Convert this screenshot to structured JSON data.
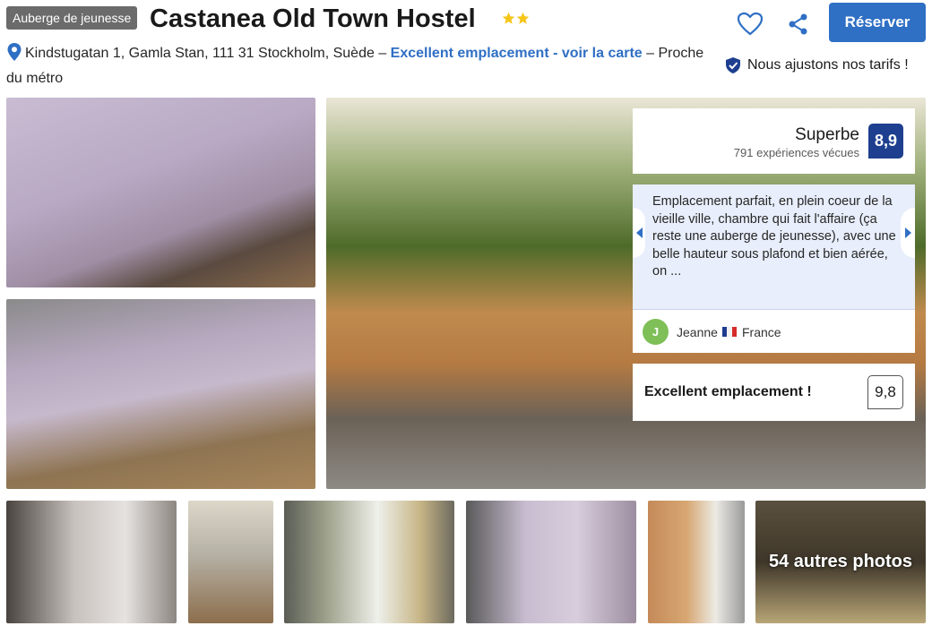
{
  "header": {
    "badge": "Auberge de jeunesse",
    "title": "Castanea Old Town Hostel",
    "stars": 2,
    "star_color": "#f5c518",
    "reserve_label": "Réserver",
    "favorite_icon": "heart-icon",
    "share_icon": "share-icon"
  },
  "address": {
    "text": "Kindstugatan 1, Gamla Stan, 111 31 Stockholm, Suède – ",
    "map_link": "Excellent emplacement - voir la carte",
    "suffix": " – Proche du métro",
    "pin_icon": "map-pin-icon"
  },
  "price_match": {
    "label": "Nous ajustons nos tarifs !",
    "icon": "shield-check-icon"
  },
  "rating": {
    "label": "Superbe",
    "count": "791 expériences vécues",
    "score": "8,9",
    "score_color": "#1e3f8f"
  },
  "review": {
    "text": "Emplacement parfait, en plein coeur de la vieille ville, chambre qui fait l'affaire (ça reste une auberge de jeunesse), avec une belle hauteur sous plafond et bien aérée, on ...",
    "avatar_initial": "J",
    "reviewer": "Jeanne",
    "country": "France"
  },
  "location": {
    "label": "Excellent emplacement !",
    "score": "9,8"
  },
  "gallery": {
    "more_label": "54 autres photos"
  },
  "colors": {
    "accent": "#2f6fc4",
    "badge_bg": "#6b6b6b"
  }
}
